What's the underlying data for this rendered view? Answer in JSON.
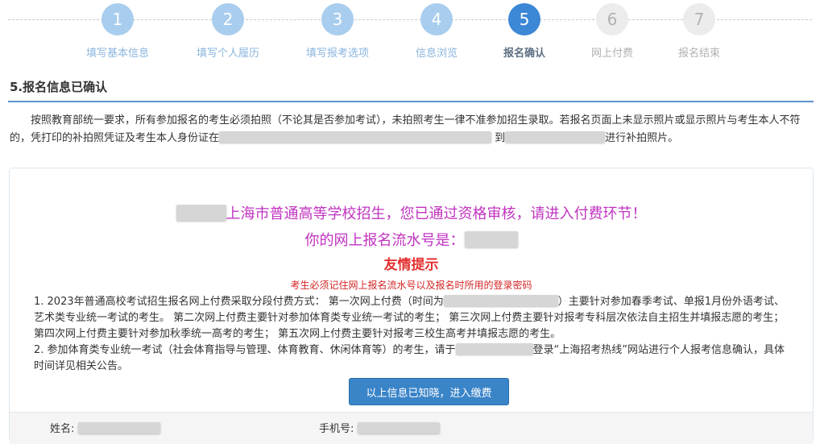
{
  "stepper": {
    "steps": [
      {
        "number": "1",
        "label": "填写基本信息",
        "state": "done"
      },
      {
        "number": "2",
        "label": "填写个人履历",
        "state": "done"
      },
      {
        "number": "3",
        "label": "填写报考选项",
        "state": "done"
      },
      {
        "number": "4",
        "label": "信息浏览",
        "state": "done"
      },
      {
        "number": "5",
        "label": "报名确认",
        "state": "current"
      },
      {
        "number": "6",
        "label": "网上付费",
        "state": "todo"
      },
      {
        "number": "7",
        "label": "报名结束",
        "state": "todo"
      }
    ]
  },
  "section": {
    "title": "5.报名信息已确认"
  },
  "notice": {
    "part1": "按照教育部统一要求，所有参加报名的考生必须拍照（不论其是否参加考试），未拍照考生一律不准参加招生录取。若报名页面上未显示照片或显示照片与考生本人不符的，凭打印的补拍照凭证及考生本人身份证在",
    "part2": "到",
    "part3": "进行补拍照片。"
  },
  "card": {
    "headline1": "上海市普通高等学校招生，您已通过资格审核，请进入付费环节！",
    "headline2": "你的网上报名流水号是：",
    "tip_title": "友情提示",
    "tip_sub": "考生必须记住网上报名流水号以及报名时所用的登录密码",
    "item1_a": "1. 2023年普通高校考试招生报名网上付费采取分段付费方式： 第一次网上付费（时间为",
    "item1_b": "）主要针对参加春季考试、单报1月份外语考试、艺术类专业统一考试的考生。 第二次网上付费主要针对参加体育类专业统一考试的考生； 第三次网上付费主要针对报考专科层次依法自主招生并填报志愿的考生； 第四次网上付费主要针对参加秋季统一高考的考生； 第五次网上付费主要针对报考三校生高考并填报志愿的考生。",
    "item2_a": "2. 参加体育类专业统一考试（社会体育指导与管理、体育教育、休闲体育等）的考生，请于",
    "item2_b": "登录“上海招考热线”网站进行个人报考信息确认，具体时间详见相关公告。",
    "confirm_button": "以上信息已知晓，进入缴费",
    "name_label": "姓名:",
    "phone_label": "手机号:"
  }
}
